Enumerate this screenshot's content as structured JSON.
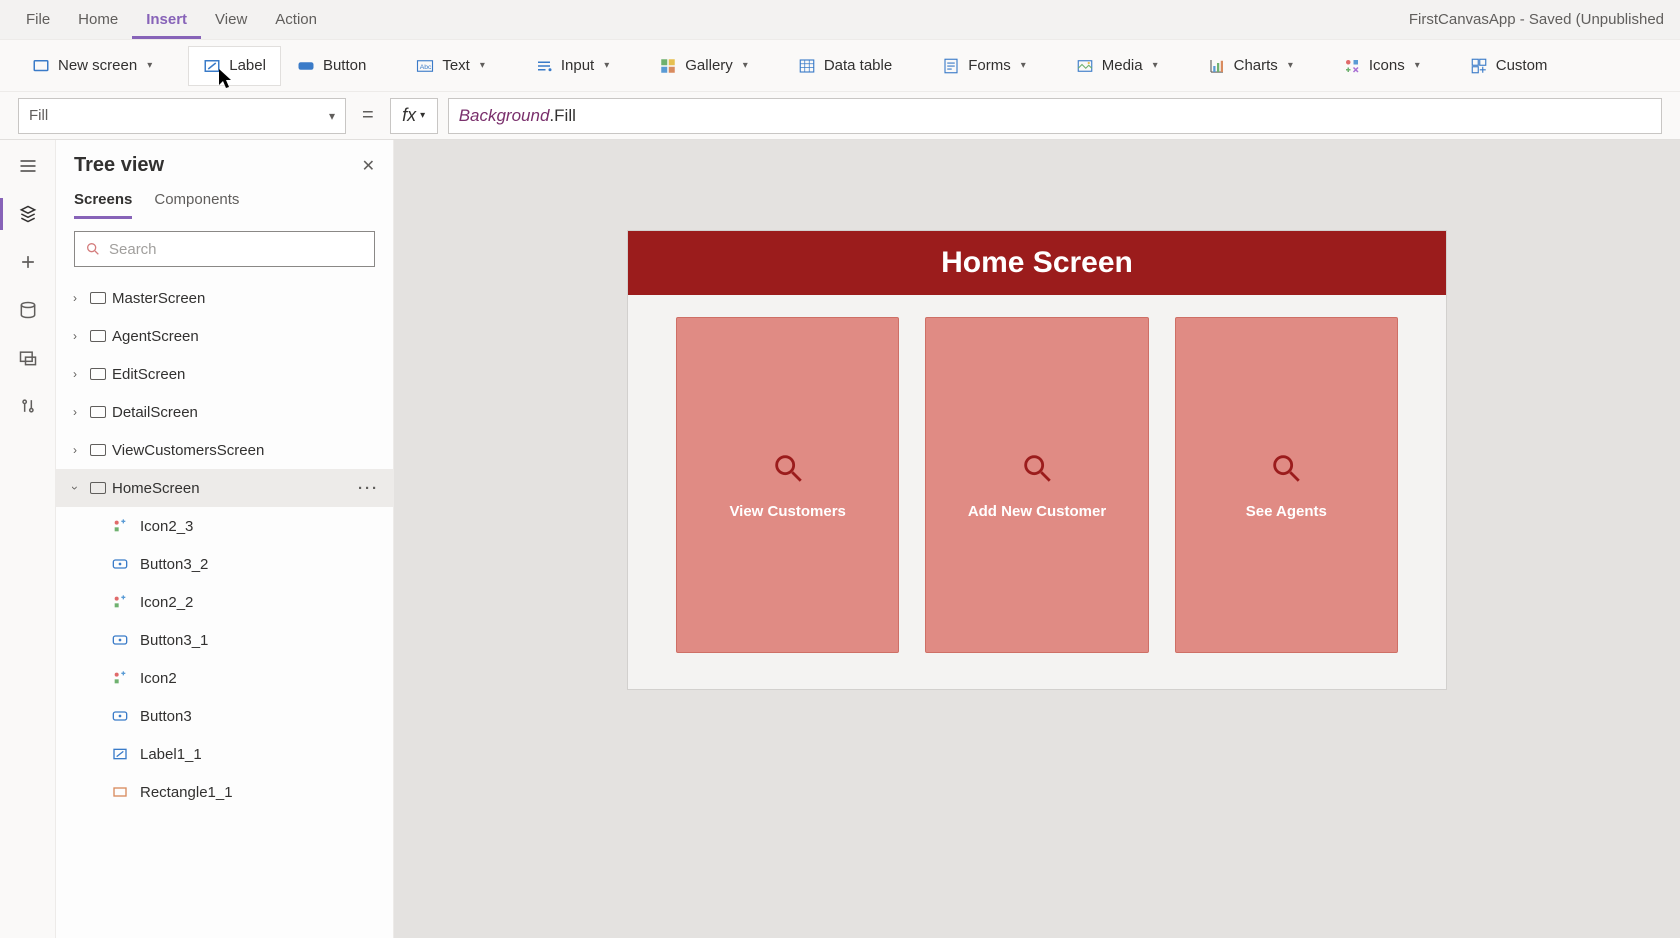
{
  "app_title": "FirstCanvasApp - Saved (Unpublished",
  "menu": {
    "file": "File",
    "home": "Home",
    "insert": "Insert",
    "view": "View",
    "action": "Action"
  },
  "ribbon": {
    "new_screen": "New screen",
    "label": "Label",
    "button": "Button",
    "text": "Text",
    "input": "Input",
    "gallery": "Gallery",
    "data_table": "Data table",
    "forms": "Forms",
    "media": "Media",
    "charts": "Charts",
    "icons": "Icons",
    "custom": "Custom"
  },
  "formula": {
    "property": "Fill",
    "equals": "=",
    "fx": "fx",
    "expr_obj": "Background",
    "expr_dot": ".",
    "expr_prop": "Fill"
  },
  "tree": {
    "title": "Tree view",
    "tab_screens": "Screens",
    "tab_components": "Components",
    "search_placeholder": "Search",
    "screens": [
      {
        "name": "MasterScreen"
      },
      {
        "name": "AgentScreen"
      },
      {
        "name": "EditScreen"
      },
      {
        "name": "DetailScreen"
      },
      {
        "name": "ViewCustomersScreen"
      }
    ],
    "selected_screen": "HomeScreen",
    "children": [
      {
        "name": "Icon2_3",
        "kind": "icon"
      },
      {
        "name": "Button3_2",
        "kind": "button"
      },
      {
        "name": "Icon2_2",
        "kind": "icon"
      },
      {
        "name": "Button3_1",
        "kind": "button"
      },
      {
        "name": "Icon2",
        "kind": "icon"
      },
      {
        "name": "Button3",
        "kind": "button"
      },
      {
        "name": "Label1_1",
        "kind": "label"
      },
      {
        "name": "Rectangle1_1",
        "kind": "rect"
      }
    ]
  },
  "canvas": {
    "header": "Home Screen",
    "tiles": [
      {
        "label": "View Customers"
      },
      {
        "label": "Add New Customer"
      },
      {
        "label": "See Agents"
      }
    ]
  }
}
